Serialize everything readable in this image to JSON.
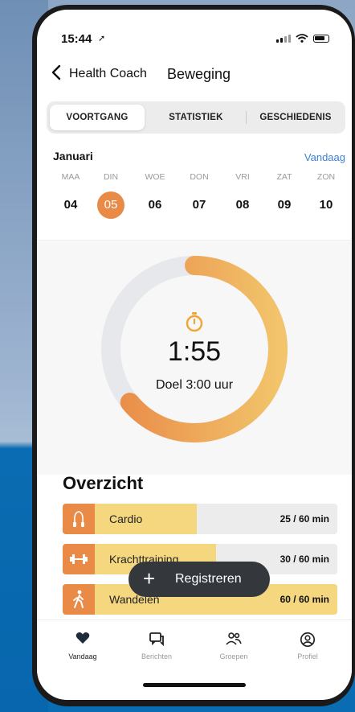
{
  "status": {
    "time": "15:44"
  },
  "nav": {
    "back_label": "Health Coach",
    "title": "Beweging"
  },
  "tabs": [
    {
      "label": "VOORTGANG",
      "active": true
    },
    {
      "label": "STATISTIEK",
      "active": false
    },
    {
      "label": "GESCHIEDENIS",
      "active": false
    }
  ],
  "week": {
    "month": "Januari",
    "today_label": "Vandaag",
    "days": [
      {
        "name": "MAA",
        "num": "04"
      },
      {
        "name": "DIN",
        "num": "05",
        "selected": true
      },
      {
        "name": "WOE",
        "num": "06"
      },
      {
        "name": "DON",
        "num": "07"
      },
      {
        "name": "VRI",
        "num": "08"
      },
      {
        "name": "ZAT",
        "num": "09"
      },
      {
        "name": "ZON",
        "num": "10"
      }
    ]
  },
  "progress": {
    "elapsed": "1:55",
    "goal": "Doel 3:00 uur",
    "fraction": 0.64,
    "colors": {
      "start": "#e98a47",
      "end": "#f2c46b",
      "track": "#e6e8ec"
    }
  },
  "overview": {
    "title": "Overzicht",
    "items": [
      {
        "label": "Cardio",
        "value": "25 / 60 min",
        "fraction": 0.42,
        "icon": "jump-rope-icon"
      },
      {
        "label": "Krachttraining",
        "value": "30 / 60 min",
        "fraction": 0.5,
        "icon": "dumbbell-icon"
      },
      {
        "label": "Wandelen",
        "value": "60 / 60 min",
        "fraction": 1.0,
        "icon": "walking-icon"
      }
    ]
  },
  "fab": {
    "label": "Registreren"
  },
  "tabbar": [
    {
      "label": "Vandaag",
      "icon": "heart-icon",
      "active": true
    },
    {
      "label": "Berichten",
      "icon": "chat-icon",
      "active": false
    },
    {
      "label": "Groepen",
      "icon": "group-icon",
      "active": false
    },
    {
      "label": "Profiel",
      "icon": "profile-icon",
      "active": false
    }
  ],
  "colors": {
    "accent": "#e98a47",
    "bar_fill": "#f4d77f",
    "link": "#3b82d6"
  }
}
